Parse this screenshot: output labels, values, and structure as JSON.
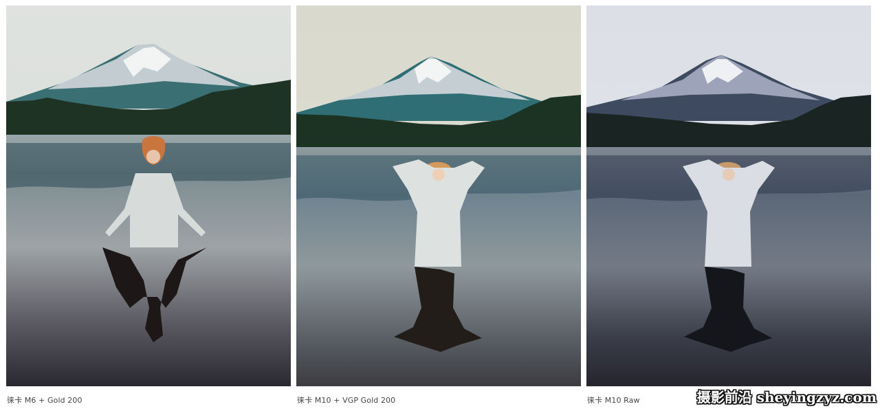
{
  "gallery": {
    "photos": [
      {
        "caption": "徕卡 M6 + Gold 200"
      },
      {
        "caption": "徕卡 M10 + VGP Gold 200"
      },
      {
        "caption": "徕卡 M10 Raw"
      }
    ]
  },
  "watermark": {
    "text": "摄影前沿 sheyingzyz.com"
  },
  "colors": {
    "sky_p1": "#dfe2df",
    "sky_p2": "#dcdcd0",
    "sky_p3": "#d8dbe4",
    "forest": "#1f3324",
    "water_dark": "#25252c"
  }
}
